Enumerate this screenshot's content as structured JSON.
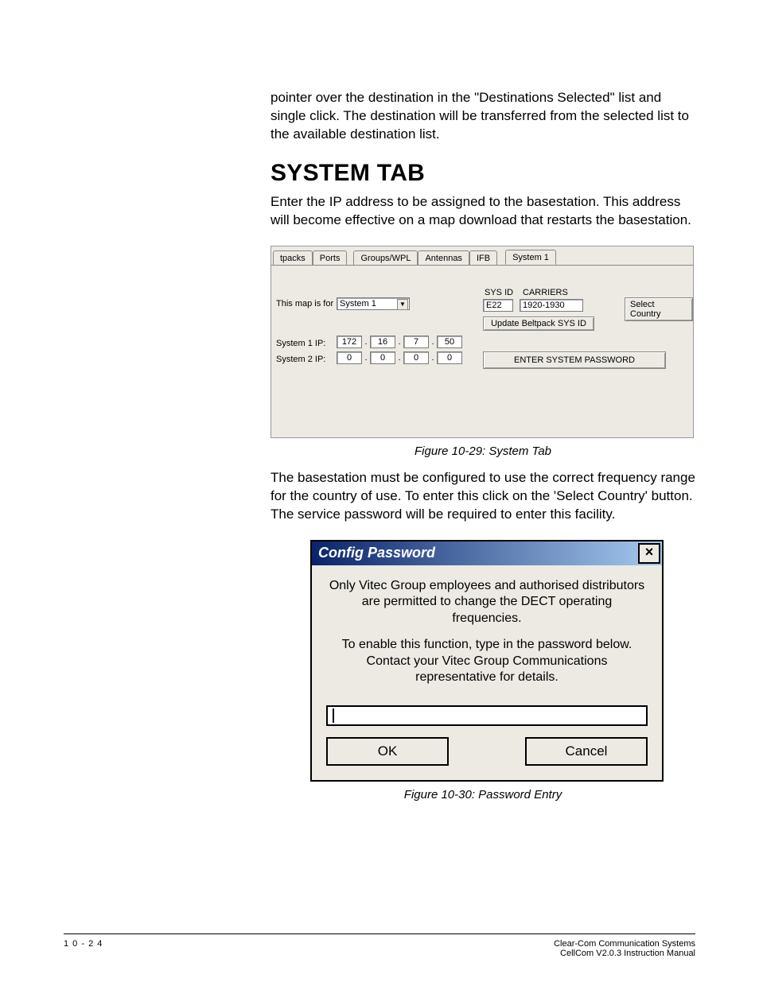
{
  "intro_paragraph": "pointer over the destination in the \"Destinations Selected\" list and single click.  The destination will be transferred from the selected list to the available destination list.",
  "heading": "SYSTEM TAB",
  "after_heading": "Enter the IP address to be assigned to the basestation.  This address will become effective on a map download that restarts the basestation.",
  "fig29": {
    "tabs": [
      "tpacks",
      "Ports",
      "Groups/WPL",
      "Antennas",
      "IFB",
      "System 1"
    ],
    "active_tab": "System 1",
    "map_label": "This map is for",
    "map_value": "System 1",
    "sys1_ip_label": "System 1 IP:",
    "sys2_ip_label": "System 2 IP:",
    "sys1_ip": [
      "172",
      "16",
      "7",
      "50"
    ],
    "sys2_ip": [
      "0",
      "0",
      "0",
      "0"
    ],
    "sysid_label": "SYS ID",
    "carriers_label": "CARRIERS",
    "sysid_value": "E22",
    "carriers_value": "1920-1930",
    "select_country_btn": "Select Country",
    "update_btn": "Update Beltpack SYS ID",
    "enter_pwd_btn": "ENTER SYSTEM PASSWORD"
  },
  "fig29_caption": "Figure 10-29: System Tab",
  "mid_paragraph": "The basestation must be configured to use the correct frequency range for the country of use.  To enter this click on the 'Select Country' button.  The service password will be required to enter this facility.",
  "fig30": {
    "title": "Config Password",
    "msg1": "Only Vitec Group employees and authorised distributors are permitted to change the DECT operating frequencies.",
    "msg2": "To enable this function, type in the password below. Contact your Vitec Group Communications representative for details.",
    "ok": "OK",
    "cancel": "Cancel"
  },
  "fig30_caption": "Figure 10-30: Password Entry",
  "footer": {
    "left": "1 0 - 2 4",
    "right1": "Clear-Com Communication Systems",
    "right2": "CellCom V2.0.3 Instruction Manual"
  }
}
